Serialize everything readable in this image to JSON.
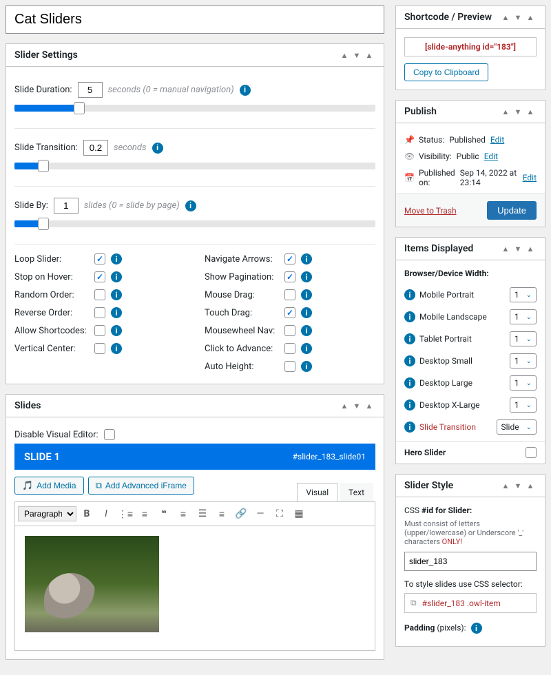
{
  "title": "Cat Sliders",
  "settings": {
    "heading": "Slider Settings",
    "duration": {
      "label": "Slide Duration:",
      "value": "5",
      "hint": "seconds (0 = manual navigation)",
      "percent": 18
    },
    "transition": {
      "label": "Slide Transition:",
      "value": "0.2",
      "hint": "seconds",
      "percent": 8
    },
    "slideby": {
      "label": "Slide By:",
      "value": "1",
      "hint": "slides (0 = slide by page)",
      "percent": 8
    },
    "left": [
      {
        "label": "Loop Slider:",
        "checked": true
      },
      {
        "label": "Stop on Hover:",
        "checked": true
      },
      {
        "label": "Random Order:",
        "checked": false
      },
      {
        "label": "Reverse Order:",
        "checked": false
      },
      {
        "label": "Allow Shortcodes:",
        "checked": false
      },
      {
        "label": "Vertical Center:",
        "checked": false
      }
    ],
    "right": [
      {
        "label": "Navigate Arrows:",
        "checked": true
      },
      {
        "label": "Show Pagination:",
        "checked": true
      },
      {
        "label": "Mouse Drag:",
        "checked": false
      },
      {
        "label": "Touch Drag:",
        "checked": true
      },
      {
        "label": "Mousewheel Nav:",
        "checked": false
      },
      {
        "label": "Click to Advance:",
        "checked": false
      },
      {
        "label": "Auto Height:",
        "checked": false
      }
    ]
  },
  "slides": {
    "heading": "Slides",
    "disable_editor": "Disable Visual Editor:",
    "slide_title": "SLIDE 1",
    "anchor": "#slider_183_slide01",
    "add_media": "Add Media",
    "add_iframe": "Add Advanced iFrame",
    "visual_tab": "Visual",
    "text_tab": "Text",
    "paragraph": "Paragraph"
  },
  "shortcode": {
    "heading": "Shortcode / Preview",
    "code": "[slide-anything id=\"183\"]",
    "copy": "Copy to Clipboard"
  },
  "publish": {
    "heading": "Publish",
    "status_label": "Status:",
    "status_value": "Published",
    "visibility_label": "Visibility:",
    "visibility_value": "Public",
    "published_label": "Published on:",
    "published_value": "Sep 14, 2022 at 23:14",
    "edit": "Edit",
    "trash": "Move to Trash",
    "update": "Update"
  },
  "items": {
    "heading": "Items Displayed",
    "subhead": "Browser/Device Width:",
    "rows": [
      {
        "label": "Mobile Portrait",
        "value": "1"
      },
      {
        "label": "Mobile Landscape",
        "value": "1"
      },
      {
        "label": "Tablet Portrait",
        "value": "1"
      },
      {
        "label": "Desktop Small",
        "value": "1"
      },
      {
        "label": "Desktop Large",
        "value": "1"
      },
      {
        "label": "Desktop X-Large",
        "value": "1"
      }
    ],
    "transition_label": "Slide Transition",
    "transition_value": "Slide",
    "hero": "Hero Slider"
  },
  "style": {
    "heading": "Slider Style",
    "css_label_pre": "CSS ",
    "css_label_mid": "#id",
    "css_label_post": " for Slider:",
    "hint_a": "Must consist of letters (upper/lowercase) or Underscore '_' characters ",
    "hint_b": "ONLY!",
    "id_value": "slider_183",
    "selector_hint": "To style slides use CSS selector:",
    "selector_value": "#slider_183 .owl-item",
    "padding_pre": "Padding ",
    "padding_mid": "(pixels)",
    "padding_post": ":"
  }
}
